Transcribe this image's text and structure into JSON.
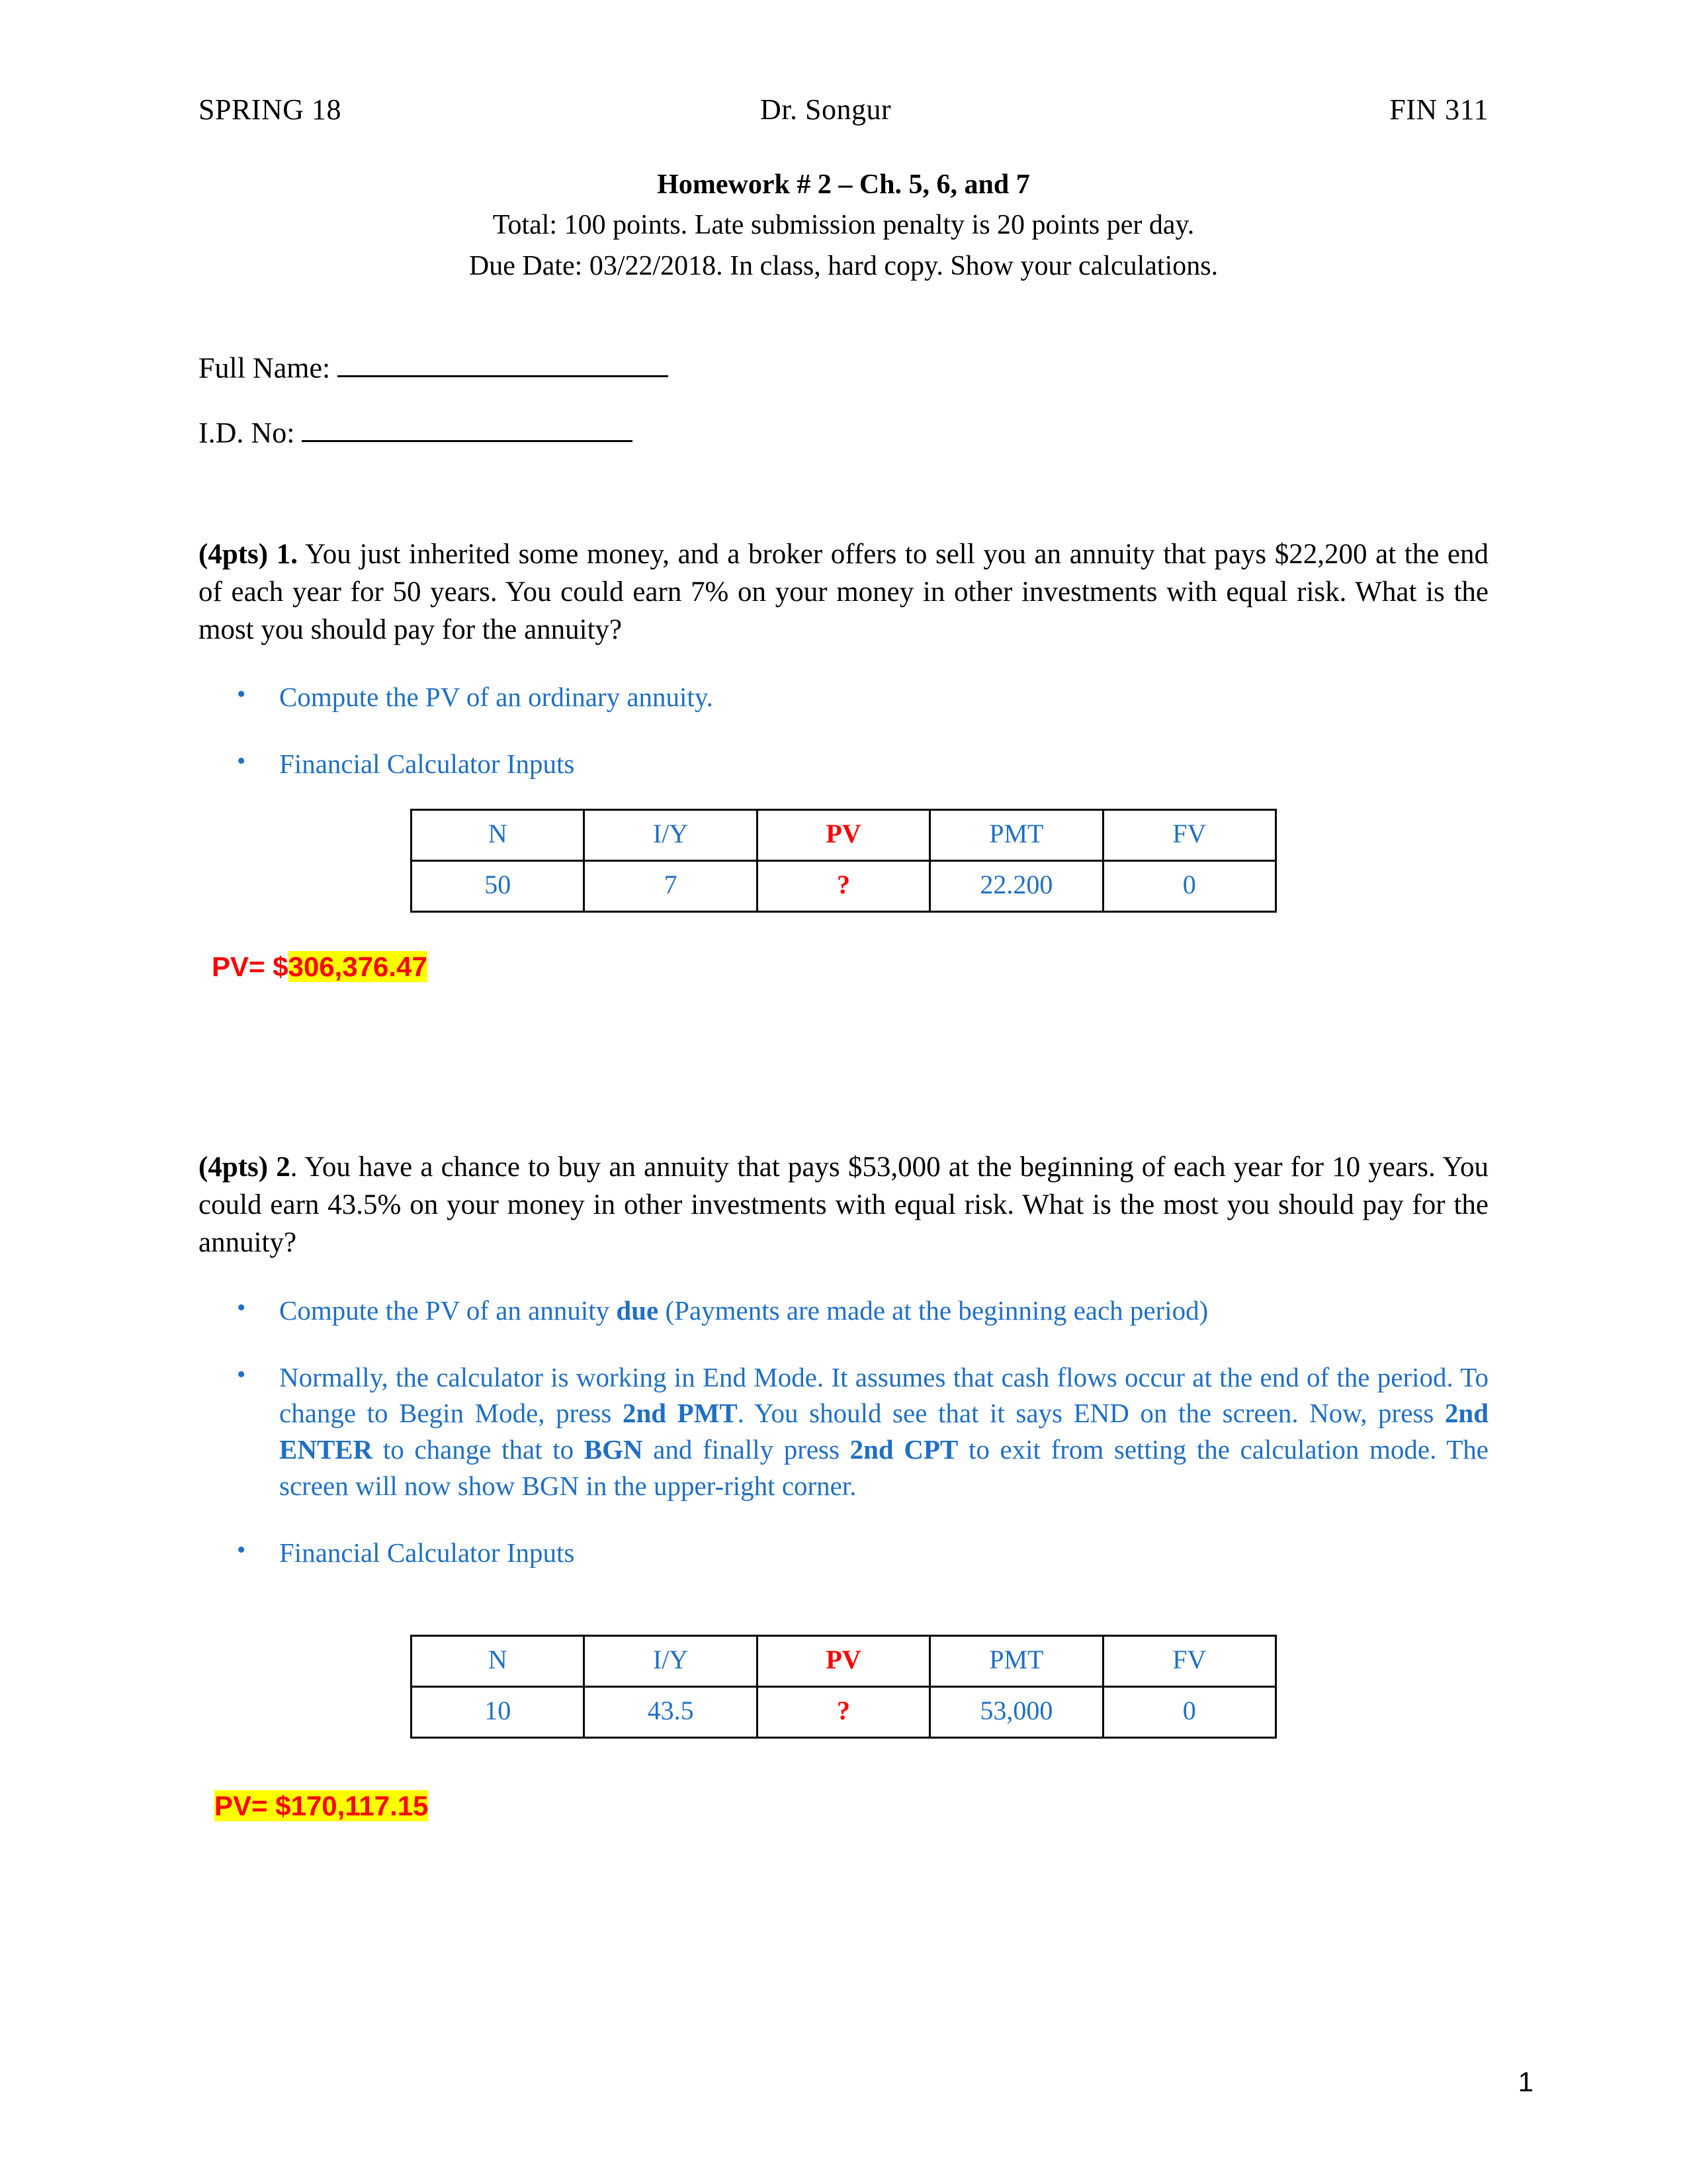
{
  "header": {
    "term": "SPRING 18",
    "instructor": "Dr. Songur",
    "course": "FIN 311"
  },
  "title": {
    "heading": "Homework # 2 – Ch. 5, 6, and 7",
    "line1": "Total: 100 points. Late submission penalty is 20 points per day.",
    "line2": "Due Date: 03/22/2018. In class, hard copy. Show your calculations."
  },
  "fields": {
    "full_name_label": "Full Name:",
    "id_label": "I.D. No:"
  },
  "questions": [
    {
      "points_label": "(4pts)",
      "number": "1.",
      "text": "You just inherited some money, and a broker offers to sell you an annuity that pays $22,200 at the end of each year for 50 years. You could earn 7% on your money in other investments with equal risk. What is the most you should pay for the annuity?",
      "bullets": {
        "b1": "Compute the PV of an ordinary annuity.",
        "b2": "Financial Calculator Inputs"
      },
      "table": {
        "headers": [
          "N",
          "I/Y",
          "PV",
          "PMT",
          "FV"
        ],
        "values": [
          "50",
          "7",
          "?",
          "22.200",
          "0"
        ]
      },
      "answer": {
        "prefix": "PV= $",
        "value": "306,376.47"
      }
    },
    {
      "points_label": "(4pts)",
      "number": "2",
      "text": ". You have a chance to buy an annuity that pays $53,000 at the beginning of each year for 10 years. You could earn 43.5% on your money in other investments with equal risk. What is the most you should pay for the annuity?",
      "bullets": {
        "b1_part1": "Compute the PV of an annuity ",
        "b1_bold": "due",
        "b1_part2": " (Payments are made at the beginning each period)",
        "b2_p1": "Normally, the calculator is working in End Mode. It assumes that cash flows occur at the end of the period. To change to Begin Mode, press ",
        "b2_k1": "2nd PMT",
        "b2_p2": ". You should see that it says END on the screen. Now, press ",
        "b2_k2": "2nd ENTER",
        "b2_p3": " to change that to ",
        "b2_k3": "BGN",
        "b2_p4": " and finally press ",
        "b2_k4": "2nd CPT",
        "b2_p5": " to exit from setting the calculation mode. The screen will now show BGN in the upper-right corner.",
        "b3": "Financial Calculator Inputs"
      },
      "table": {
        "headers": [
          "N",
          "I/Y",
          "PV",
          "PMT",
          "FV"
        ],
        "values": [
          "10",
          "43.5",
          "?",
          "53,000",
          "0"
        ]
      },
      "answer": {
        "prefix": "PV= $",
        "value": "170,117.15"
      }
    }
  ],
  "footer": {
    "page_number": "1"
  },
  "colors": {
    "bullet_blue": "#1F6FC4",
    "answer_red": "#FF0000",
    "highlight_yellow": "#FFFF00"
  }
}
